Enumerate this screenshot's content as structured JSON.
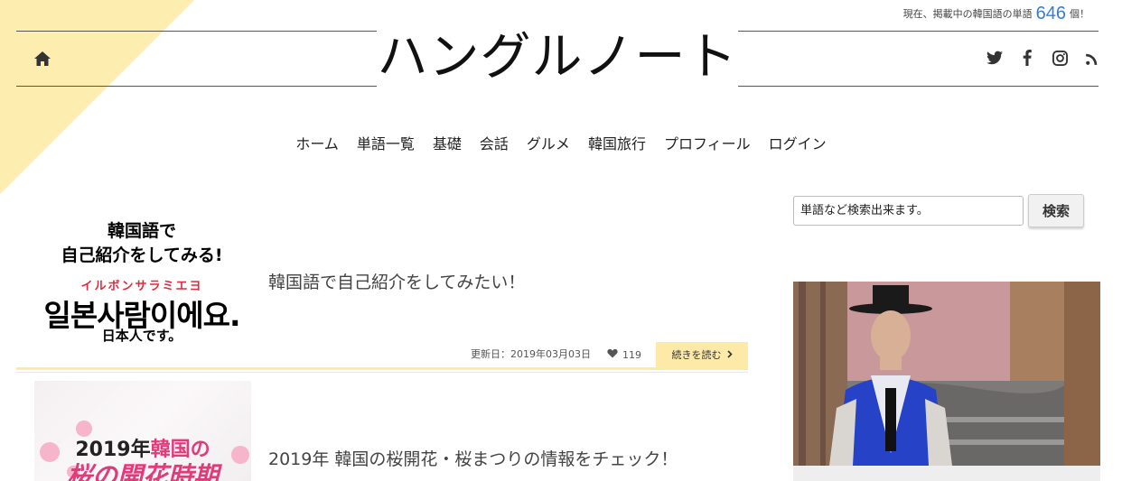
{
  "header": {
    "counter_prefix": "現在、掲載中の韓国語の単語",
    "counter_value": "646",
    "counter_suffix": "個！",
    "site_title": "ハングルノート",
    "home_icon": "home-icon",
    "social_icons": [
      "twitter-icon",
      "facebook-icon",
      "instagram-icon",
      "rss-icon"
    ]
  },
  "nav": {
    "items": [
      "ホーム",
      "単語一覧",
      "基礎",
      "会話",
      "グルメ",
      "韓国旅行",
      "プロフィール",
      "ログイン"
    ]
  },
  "search": {
    "value": "単語など検索出来ます。",
    "button_label": "検索"
  },
  "posts": [
    {
      "thumb_lines": [
        "韓国語で",
        "自己紹介をしてみる!",
        "イルボンサラミエヨ",
        "일본사람이에요.",
        "日本人です。"
      ],
      "title": "韓国語で自己紹介をしてみたい！",
      "updated": "更新日：2019年03月03日",
      "likes": "119",
      "read_more": "続きを読む"
    },
    {
      "thumb_year": "2019年",
      "thumb_pink": "韓国の",
      "thumb_line2": "桜の開花時期",
      "title": "2019年 韓国の桜開花・桜まつりの情報をチェック！"
    }
  ],
  "colors": {
    "accent_yellow": "#fde9a8",
    "corner_yellow": "#fdeeb0",
    "counter_blue": "#3a7bd5",
    "thumb_red": "#e12a3c",
    "sakura_pink": "#e23b7a"
  }
}
